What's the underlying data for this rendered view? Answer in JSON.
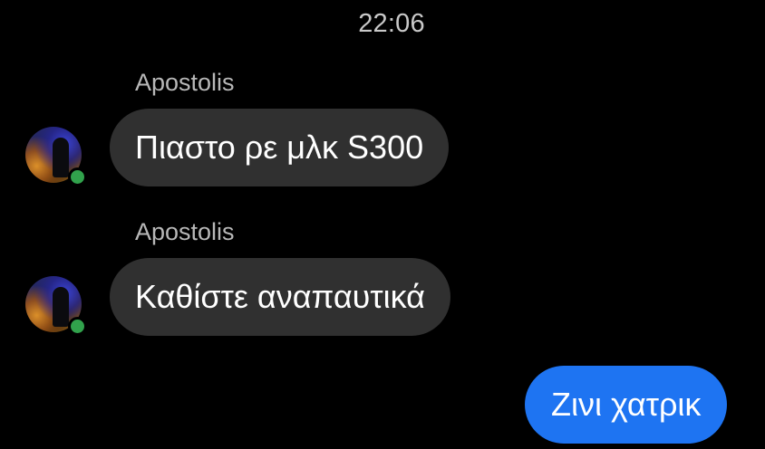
{
  "timestamp": "22:06",
  "messages": [
    {
      "sender": "Apostolis",
      "text": "Πιαστο ρε μλκ S300",
      "direction": "incoming",
      "online": true
    },
    {
      "sender": "Apostolis",
      "text": "Καθίστε αναπαυτικά",
      "direction": "incoming",
      "online": true
    },
    {
      "text": "Ζινι χατρικ",
      "direction": "outgoing"
    }
  ],
  "colors": {
    "background": "#000000",
    "incoming_bubble": "#303030",
    "outgoing_bubble": "#1e74f2",
    "online_indicator": "#31a24c",
    "sender_name": "#b8b8b8"
  },
  "icons": {
    "presence": "online-dot-icon"
  }
}
